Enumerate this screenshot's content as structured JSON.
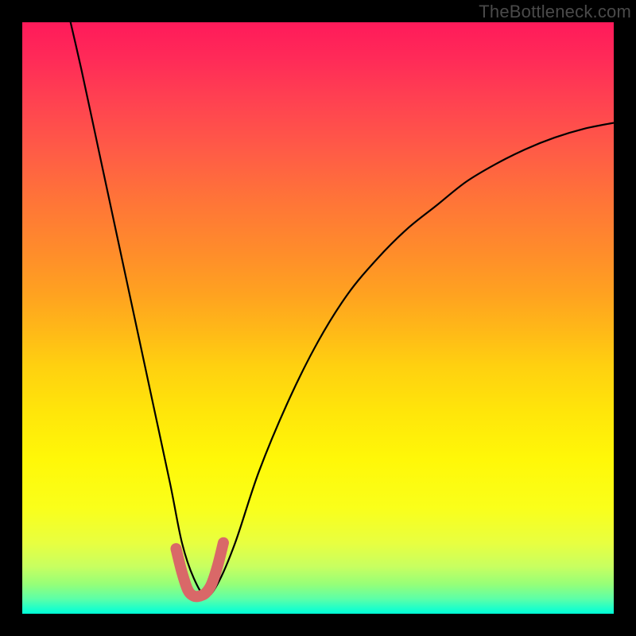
{
  "watermark": "TheBottleneck.com",
  "chart_data": {
    "type": "line",
    "title": "",
    "xlabel": "",
    "ylabel": "",
    "xlim": [
      0,
      100
    ],
    "ylim": [
      0,
      100
    ],
    "grid": false,
    "series": [
      {
        "name": "bottleneck-curve",
        "x": [
          7,
          10,
          13,
          16,
          19,
          22,
          25,
          27,
          29,
          31,
          33,
          36,
          40,
          45,
          50,
          55,
          60,
          65,
          70,
          75,
          80,
          85,
          90,
          95,
          100
        ],
        "values": [
          105,
          92,
          78,
          64,
          50,
          36,
          22,
          12,
          6,
          3,
          5,
          12,
          24,
          36,
          46,
          54,
          60,
          65,
          69,
          73,
          76,
          78.5,
          80.5,
          82,
          83
        ]
      },
      {
        "name": "optimal-highlight",
        "x": [
          26,
          27,
          28,
          29,
          30,
          31,
          32,
          33,
          34
        ],
        "values": [
          11,
          7,
          4,
          3,
          3,
          3.5,
          5,
          8,
          12
        ]
      }
    ],
    "colors": {
      "curve": "#000000",
      "highlight": "#d96868"
    },
    "background_gradient": {
      "top": "#ff1a5a",
      "mid": "#ffe60a",
      "bottom": "#00ffd8"
    }
  }
}
